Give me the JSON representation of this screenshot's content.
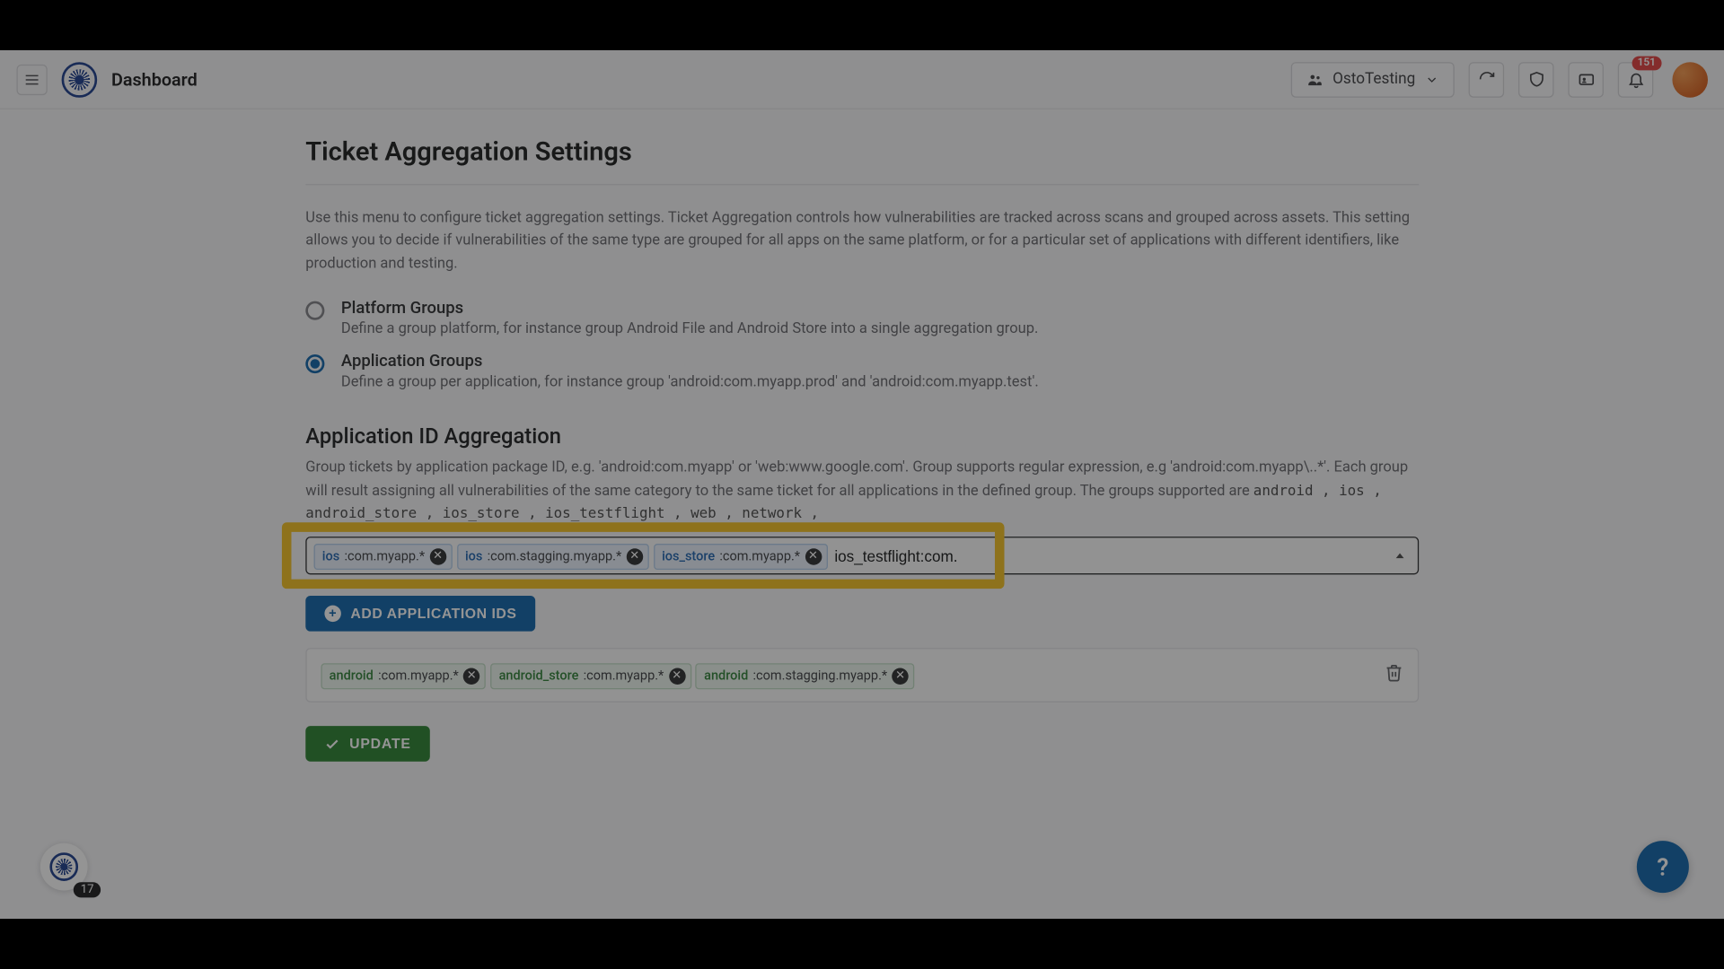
{
  "header": {
    "title": "Dashboard",
    "org_label": "OstoTesting",
    "notif_count": "151"
  },
  "page": {
    "title": "Ticket Aggregation Settings",
    "description": "Use this menu to configure ticket aggregation settings. Ticket Aggregation controls how vulnerabilities are tracked across scans and grouped across assets. This setting allows you to decide if vulnerabilities of the same type are grouped for all apps on the same platform, or for a particular set of applications with different identifiers, like production and testing."
  },
  "radios": {
    "platform": {
      "title": "Platform Groups",
      "sub": "Define a group platform, for instance group Android File and Android Store into a single aggregation group."
    },
    "application": {
      "title": "Application Groups",
      "sub": "Define a group per application, for instance group 'android:com.myapp.prod' and 'android:com.myapp.test'."
    }
  },
  "appid": {
    "title": "Application ID Aggregation",
    "desc_lead": "Group tickets by application package ID, e.g. 'android:com.myapp' or 'web:www.google.com'. Group supports regular expression, e.g 'android:com.myapp\\..*'. Each group will result assigning all vulnerabilities of the same category to the same ticket for all applications in the defined group. The groups supported are ",
    "supported": "android , ios , android_store , ios_store , ios_testflight , web , network ,",
    "chips": [
      {
        "prefix": "ios",
        "suffix": ":com.myapp.*",
        "tone": "ios"
      },
      {
        "prefix": "ios",
        "suffix": ":com.stagging.myapp.*",
        "tone": "ios"
      },
      {
        "prefix": "ios_store",
        "suffix": ":com.myapp.*",
        "tone": "ios"
      }
    ],
    "input_value": "ios_testflight:com.",
    "add_label": "ADD APPLICATION IDS",
    "group_chips": [
      {
        "prefix": "android",
        "suffix": ":com.myapp.*",
        "tone": "android"
      },
      {
        "prefix": "android_store",
        "suffix": ":com.myapp.*",
        "tone": "android"
      },
      {
        "prefix": "android",
        "suffix": ":com.stagging.myapp.*",
        "tone": "android"
      }
    ],
    "update_label": "UPDATE"
  },
  "float": {
    "count": "17"
  }
}
